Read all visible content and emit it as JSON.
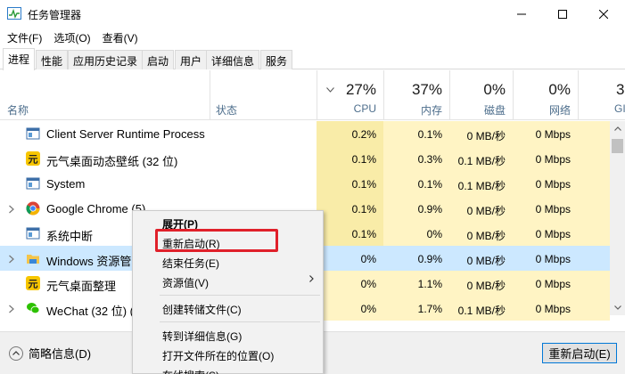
{
  "window": {
    "title": "任务管理器",
    "icons": {
      "app": "task-manager-icon",
      "minimize": "minimize-icon",
      "maximize": "maximize-icon",
      "close": "close-icon"
    }
  },
  "menu": [
    "文件(F)",
    "选项(O)",
    "查看(V)"
  ],
  "tabs": [
    "进程",
    "性能",
    "应用历史记录",
    "启动",
    "用户",
    "详细信息",
    "服务"
  ],
  "header": {
    "name": "名称",
    "status": "状态",
    "cpu": {
      "pct": "27%",
      "label": "CPU"
    },
    "memory": {
      "pct": "37%",
      "label": "内存"
    },
    "disk": {
      "pct": "0%",
      "label": "磁盘"
    },
    "network": {
      "pct": "0%",
      "label": "网络"
    },
    "gpu": {
      "pct": "3",
      "label": "GI"
    }
  },
  "rows": [
    {
      "name": "Client Server Runtime Process",
      "icon": "system-process-icon",
      "expandable": false,
      "cpu": "0.2%",
      "mem": "0.1%",
      "disk": "0 MB/秒",
      "net": "0 Mbps"
    },
    {
      "name": "元气桌面动态壁纸 (32 位)",
      "icon": "yuanqi-app-icon",
      "expandable": false,
      "cpu": "0.1%",
      "mem": "0.3%",
      "disk": "0.1 MB/秒",
      "net": "0 Mbps"
    },
    {
      "name": "System",
      "icon": "system-process-icon",
      "expandable": false,
      "cpu": "0.1%",
      "mem": "0.1%",
      "disk": "0.1 MB/秒",
      "net": "0 Mbps"
    },
    {
      "name": "Google Chrome (5)",
      "icon": "chrome-icon",
      "expandable": true,
      "cpu": "0.1%",
      "mem": "0.9%",
      "disk": "0 MB/秒",
      "net": "0 Mbps"
    },
    {
      "name": "系统中断",
      "icon": "system-process-icon",
      "expandable": false,
      "cpu": "0.1%",
      "mem": "0%",
      "disk": "0 MB/秒",
      "net": "0 Mbps"
    },
    {
      "name": "Windows 资源管",
      "icon": "explorer-folder-icon",
      "expandable": true,
      "cpu": "0%",
      "mem": "0.9%",
      "disk": "0 MB/秒",
      "net": "0 Mbps"
    },
    {
      "name": "元气桌面整理",
      "icon": "yuanqi-app-icon",
      "expandable": false,
      "cpu": "0%",
      "mem": "1.1%",
      "disk": "0 MB/秒",
      "net": "0 Mbps"
    },
    {
      "name": "WeChat (32 位) (",
      "icon": "wechat-icon",
      "expandable": true,
      "cpu": "0%",
      "mem": "1.7%",
      "disk": "0.1 MB/秒",
      "net": "0 Mbps"
    }
  ],
  "footer": {
    "fewer_details": "简略信息(D)",
    "restart_button": "重新启动(E)"
  },
  "context_menu": {
    "items": [
      {
        "label": "展开(P)",
        "bold": true
      },
      {
        "label": "重新启动(R)"
      },
      {
        "label": "结束任务(E)"
      },
      {
        "label": "资源值(V)",
        "submenu": true
      },
      {
        "label": "创建转储文件(C)"
      },
      {
        "label": "转到详细信息(G)"
      },
      {
        "label": "打开文件所在的位置(O)"
      },
      {
        "label": "在线搜索(S)"
      }
    ]
  },
  "colors": {
    "selection": "#cce8ff",
    "cpu_highlight": "#fff4c4",
    "callout": "#e0202a",
    "accent": "#0078d7"
  }
}
